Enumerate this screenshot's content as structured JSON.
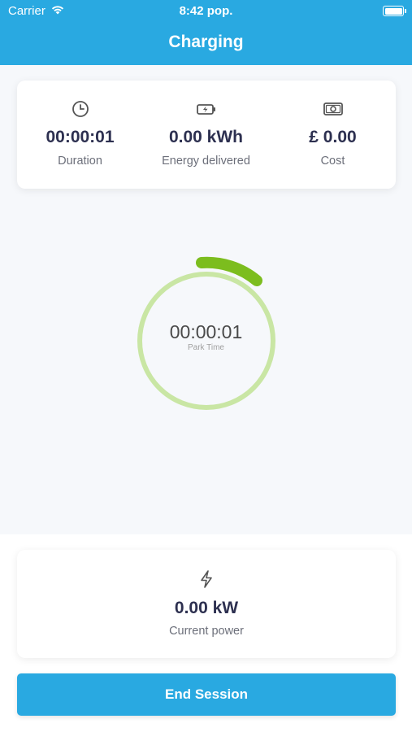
{
  "status_bar": {
    "carrier": "Carrier",
    "time": "8:42 pop."
  },
  "header": {
    "title": "Charging",
    "background_color": "#29a9e1"
  },
  "stats": [
    {
      "icon": "clock-icon",
      "value": "00:00:01",
      "label": "Duration"
    },
    {
      "icon": "battery-charging-icon",
      "value": "0.00 kWh",
      "label": "Energy delivered"
    },
    {
      "icon": "banknote-icon",
      "value": "£ 0.00",
      "label": "Cost"
    }
  ],
  "gauge": {
    "time": "00:00:01",
    "label": "Park Time",
    "ring_color": "#c9e6a4",
    "progress_color": "#7cbd1e"
  },
  "power": {
    "icon": "lightning-icon",
    "value": "0.00 kW",
    "label": "Current power"
  },
  "actions": {
    "end_session_label": "End Session"
  }
}
